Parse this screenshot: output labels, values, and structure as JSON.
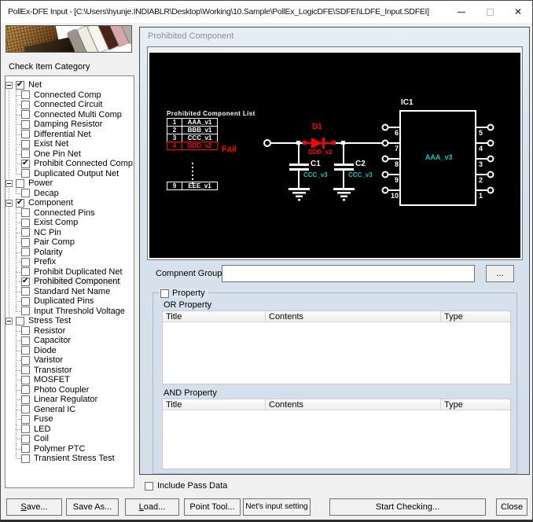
{
  "window": {
    "title": "PollEx-DFE Input - [C:\\Users\\hyunje.INDIABLR\\Desktop\\Working\\10.Sample\\PollEx_LogicDFE\\SDFEI\\LDFE_Input.SDFEI]",
    "close_glyph": "✕"
  },
  "left": {
    "category_label": "Check Item Category",
    "tree": [
      {
        "label": "Net",
        "level": 0,
        "checked": true
      },
      {
        "label": "Connected Comp",
        "level": 1,
        "checked": false
      },
      {
        "label": "Connected Circuit",
        "level": 1,
        "checked": false
      },
      {
        "label": "Connected Multi Comp",
        "level": 1,
        "checked": false
      },
      {
        "label": "Damping Resistor",
        "level": 1,
        "checked": false
      },
      {
        "label": "Differential Net",
        "level": 1,
        "checked": false
      },
      {
        "label": "Exist Net",
        "level": 1,
        "checked": false
      },
      {
        "label": "One Pin Net",
        "level": 1,
        "checked": false
      },
      {
        "label": "Prohibit Connected Comp",
        "level": 1,
        "checked": true
      },
      {
        "label": "Duplicated Output Net",
        "level": 1,
        "checked": false
      },
      {
        "label": "Power",
        "level": 0,
        "checked": false
      },
      {
        "label": "Decap",
        "level": 1,
        "checked": false
      },
      {
        "label": "Component",
        "level": 0,
        "checked": true
      },
      {
        "label": "Connected Pins",
        "level": 1,
        "checked": false
      },
      {
        "label": "Exist Comp",
        "level": 1,
        "checked": false
      },
      {
        "label": "NC Pin",
        "level": 1,
        "checked": false
      },
      {
        "label": "Pair Comp",
        "level": 1,
        "checked": false
      },
      {
        "label": "Polarity",
        "level": 1,
        "checked": false
      },
      {
        "label": "Prefix",
        "level": 1,
        "checked": false
      },
      {
        "label": "Prohibit Duplicated Net",
        "level": 1,
        "checked": false
      },
      {
        "label": "Prohibited Component",
        "level": 1,
        "checked": true,
        "selected": true
      },
      {
        "label": "Standard Net Name",
        "level": 1,
        "checked": false
      },
      {
        "label": "Duplicated Pins",
        "level": 1,
        "checked": false
      },
      {
        "label": "Input Threshold Voltage",
        "level": 1,
        "checked": false
      },
      {
        "label": "Stress Test",
        "level": 0,
        "checked": false
      },
      {
        "label": "Resistor",
        "level": 1,
        "checked": false
      },
      {
        "label": "Capacitor",
        "level": 1,
        "checked": false
      },
      {
        "label": "Diode",
        "level": 1,
        "checked": false
      },
      {
        "label": "Varistor",
        "level": 1,
        "checked": false
      },
      {
        "label": "Transistor",
        "level": 1,
        "checked": false
      },
      {
        "label": "MOSFET",
        "level": 1,
        "checked": false
      },
      {
        "label": "Photo Coupler",
        "level": 1,
        "checked": false
      },
      {
        "label": "Linear Regulator",
        "level": 1,
        "checked": false
      },
      {
        "label": "General IC",
        "level": 1,
        "checked": false
      },
      {
        "label": "Fuse",
        "level": 1,
        "checked": false
      },
      {
        "label": "LED",
        "level": 1,
        "checked": false
      },
      {
        "label": "Coil",
        "level": 1,
        "checked": false
      },
      {
        "label": "Polymer PTC",
        "level": 1,
        "checked": false
      },
      {
        "label": "Transient Stress Test",
        "level": 1,
        "checked": false
      }
    ]
  },
  "canvas": {
    "list_title": "Prohibited Component List",
    "list_rows": [
      {
        "no": "1",
        "name": "AAA_v1"
      },
      {
        "no": "2",
        "name": "BBB_v1"
      },
      {
        "no": "3",
        "name": "CCC_v1"
      },
      {
        "no": "4",
        "name": "DDD_v2"
      },
      {
        "no": "9",
        "name": "EEE_v1"
      }
    ],
    "fail_label": "Fail",
    "diode": {
      "ref": "D1",
      "part": "DDD_v2"
    },
    "cap1": {
      "ref": "C1",
      "part": "CCC_v3"
    },
    "cap2": {
      "ref": "C2",
      "part": "CCC_v3"
    },
    "ic": {
      "ref": "IC1",
      "part": "AAA_v3",
      "left_pins": [
        "6",
        "7",
        "8",
        "9",
        "10"
      ],
      "right_pins": [
        "5",
        "4",
        "3",
        "2",
        "1"
      ]
    },
    "colors": {
      "fail": "#ff0000",
      "part_label": "#00cccc",
      "wire": "#ffffff"
    }
  },
  "right": {
    "group_label": "Prohibited Component",
    "component_group_label": "Compnent Group",
    "component_group_value": "",
    "browse_label": "...",
    "property_label": "Property",
    "or_label": "OR Property",
    "and_label": "AND Property",
    "columns": [
      "Title",
      "Contents",
      "Type"
    ],
    "include_pass_label": "Include Pass Data"
  },
  "buttons": [
    {
      "label": "Save...",
      "underline_first": true
    },
    {
      "label": "Save As...",
      "underline_first": false
    },
    {
      "label": "Load...",
      "underline_first": true
    },
    {
      "label": "Point Tool...",
      "underline_first": false
    },
    {
      "label": "Net's input setting",
      "underline_first": false
    },
    {
      "label": "Start Checking...",
      "underline_first": false
    },
    {
      "label": "Close",
      "underline_first": false
    }
  ]
}
